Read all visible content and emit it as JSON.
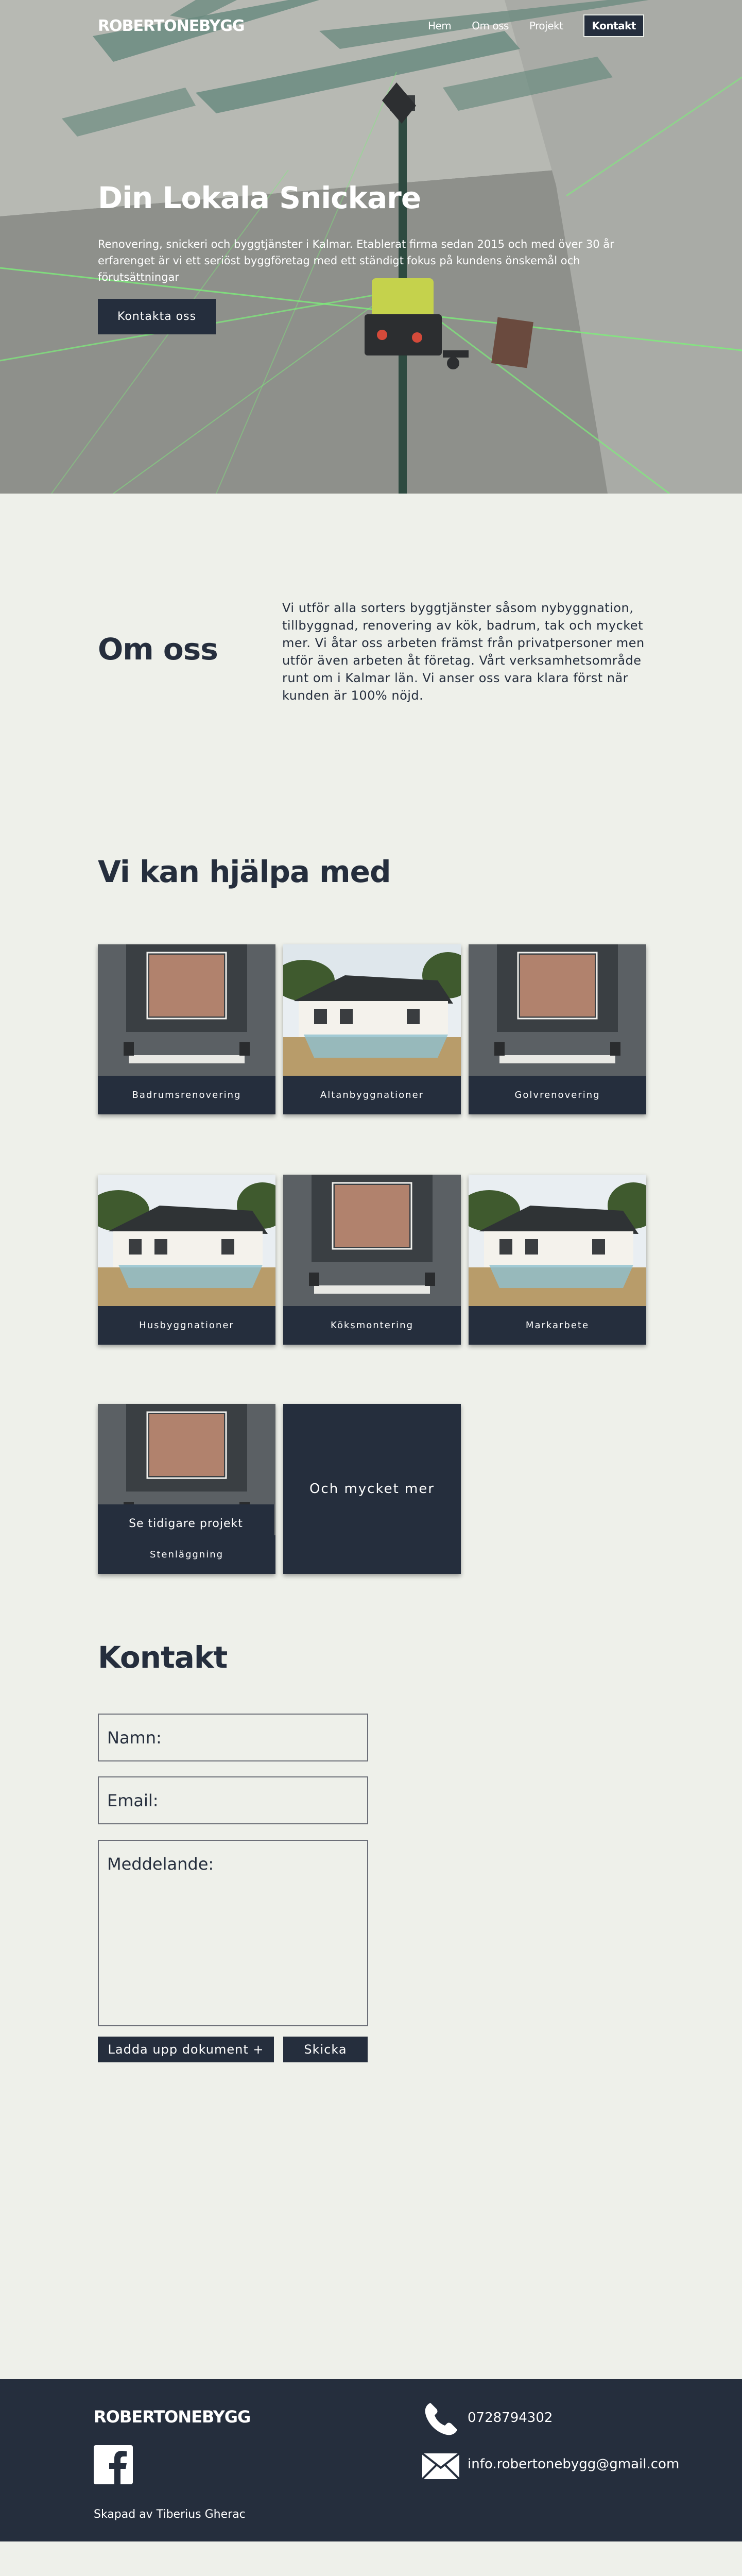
{
  "nav": {
    "logo": "ROBERTONEBYGG",
    "links": [
      "Hem",
      "Om oss",
      "Projekt"
    ],
    "cta": "Kontakt"
  },
  "hero": {
    "title": "Din Lokala Snickare",
    "text": "Renovering, snickeri och byggtjänster i Kalmar. Etablerat firma sedan 2015 och med över 30 år erfarenget är vi ett seriöst byggföretag med ett ständigt fokus på kundens önskemål och förutsättningar",
    "button": "Kontakta oss"
  },
  "about": {
    "title": "Om oss",
    "text": "Vi utför alla sorters byggtjänster såsom nybyggnation, tillbyggnad, renovering av kök, badrum, tak och mycket mer. Vi åtar oss arbeten främst från privatpersoner men utför även arbeten åt företag. Vårt verksamhetsområde runt om i Kalmar län. Vi anser oss vara klara först när kunden är 100% nöjd."
  },
  "services": {
    "title": "Vi kan hjälpa med",
    "items": [
      {
        "label": "Badrumsrenovering",
        "image": "bathroom"
      },
      {
        "label": "Altanbyggnationer",
        "image": "house"
      },
      {
        "label": "Golvrenovering",
        "image": "bathroom"
      },
      {
        "label": "Husbyggnationer",
        "image": "house"
      },
      {
        "label": "Köksmontering",
        "image": "bathroom"
      },
      {
        "label": "Markarbete",
        "image": "house"
      },
      {
        "label": "Stenläggning",
        "image": "bathroom"
      }
    ],
    "more": "Och mycket mer",
    "projects_button": "Se tidigare projekt"
  },
  "contact": {
    "title": "Kontakt",
    "name_placeholder": "Namn:",
    "email_placeholder": "Email:",
    "message_placeholder": "Meddelande:",
    "upload_button": "Ladda upp dokument +",
    "send_button": "Skicka"
  },
  "footer": {
    "logo": "ROBERTONEBYGG",
    "phone": "0728794302",
    "email": "info.robertonebygg@gmail.com",
    "credit": "Skapad av Tiberius Gherac",
    "icons": [
      "facebook-icon",
      "phone-icon",
      "mail-icon"
    ]
  },
  "colors": {
    "navy": "#252e3d",
    "background": "#eef0ea",
    "laser_green": "#7df07a"
  }
}
